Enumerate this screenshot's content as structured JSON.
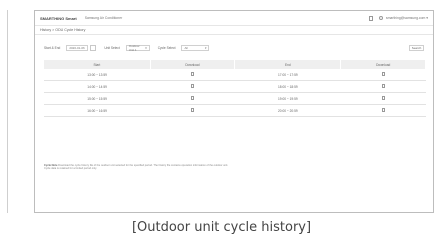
{
  "app": {
    "brand_prefix": "SMARTHING",
    "brand_name": "Smart",
    "subtitle": "Samsung Air Conditioner"
  },
  "account": {
    "email": "smarthing@samsung.com ▾"
  },
  "breadcrumb": "History > ODU Cycle History",
  "filters": {
    "period_label": "Start & End",
    "date_value": "2020-01-06",
    "unit_label": "Unit Select",
    "unit_value": "Outdoor Unit 1",
    "cycle_label": "Cycle Select",
    "cycle_value": "All",
    "search_label": "Search"
  },
  "table": {
    "columns": [
      "Start",
      "Download",
      "End",
      "Download"
    ],
    "rows": [
      [
        "13:00 ~ 13:59",
        "",
        "17:00 ~ 17:59",
        ""
      ],
      [
        "14:00 ~ 14:59",
        "",
        "18:00 ~ 18:59",
        ""
      ],
      [
        "15:00 ~ 15:59",
        "",
        "19:00 ~ 19:59",
        ""
      ],
      [
        "16:00 ~ 16:59",
        "",
        "20:00 ~ 20:59",
        ""
      ]
    ]
  },
  "note": {
    "title": "Cycle Note",
    "line1": "Download the cycle history file of the outdoor unit selected for the specified period. The history file contains operation information of the outdoor unit.",
    "line2": "Cycle data is retained for a limited period only."
  },
  "caption": "[Outdoor unit cycle history]"
}
